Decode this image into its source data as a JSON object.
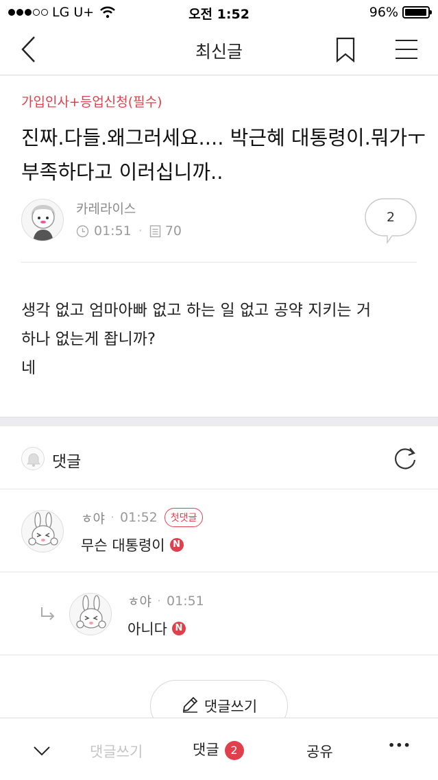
{
  "status_bar": {
    "carrier": "LG U+",
    "time": "오전 1:52",
    "battery": "96%",
    "battery_level": 0.96
  },
  "nav": {
    "title": "최신글",
    "icons": [
      "back-arrow-icon",
      "bookmark-icon",
      "menu-icon"
    ]
  },
  "post": {
    "category": "가입인사+등업신청(필수)",
    "title": "진짜.다들.왜그러세요.... 박근혜 대통령이.뭐가ㅜ부족하다고 이러십니까..",
    "author": "카레라이스",
    "time": "01:51",
    "views": "70",
    "comment_count": "2",
    "body_lines": [
      "생각 없고 엄마아빠 없고 하는 일 없고 공약 지키는 거",
      "하나 없는게 좝니까?",
      "네"
    ]
  },
  "comments_section": {
    "label": "댓글",
    "comments": [
      {
        "author": "ㅎ야",
        "time": "01:52",
        "badge": "첫댓글",
        "text": "무슨 대통령이",
        "new_badge": "N"
      },
      {
        "author": "ㅎ야",
        "time": "01:51",
        "text": "아니다",
        "new_badge": "N"
      }
    ],
    "write_button": "댓글쓰기"
  },
  "bottom_bar": {
    "write": "댓글쓰기",
    "comments": "댓글",
    "comments_count": "2",
    "share": "공유",
    "more": "•••"
  },
  "colors": {
    "accent": "#e0404b",
    "muted": "#999999",
    "divider": "#e6e6e6"
  }
}
